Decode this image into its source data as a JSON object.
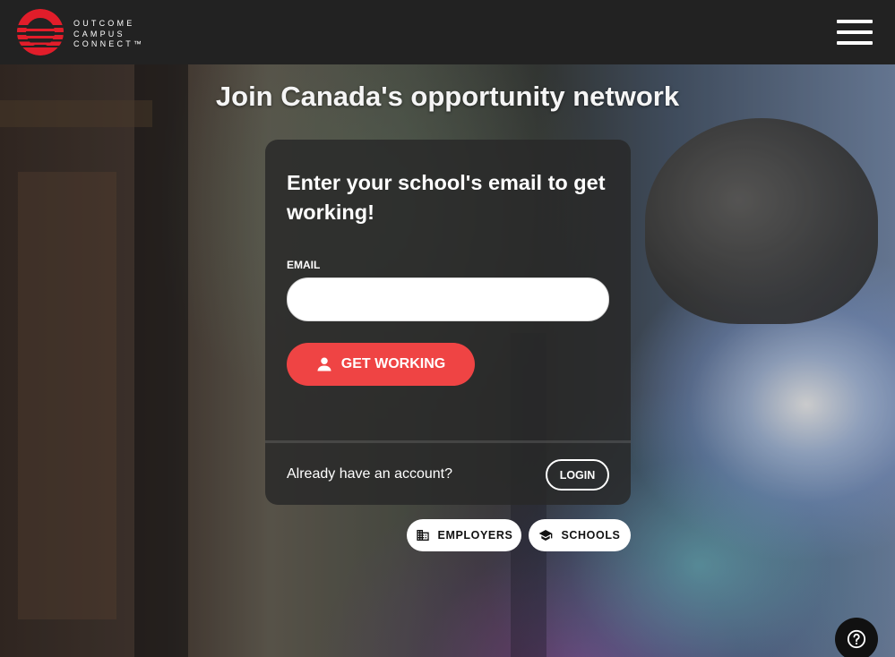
{
  "header": {
    "logo_lines": [
      "OUTCOME",
      "CAMPUS",
      "CONNECT™"
    ],
    "logo_color": "#e11d2a",
    "menu_icon": "hamburger-menu-icon"
  },
  "hero": {
    "headline": "Join Canada's opportunity network"
  },
  "card": {
    "title": "Enter your school's email to get working!",
    "email_label": "EMAIL",
    "email_value": "",
    "email_placeholder": "",
    "submit_label": "GET WORKING",
    "submit_icon": "person-icon",
    "submit_color": "#ef4444",
    "account_prompt": "Already have an account?",
    "login_label": "LOGIN"
  },
  "audience": {
    "employers_label": "EMPLOYERS",
    "employers_icon": "building-icon",
    "schools_label": "SCHOOLS",
    "schools_icon": "graduation-cap-icon"
  },
  "help": {
    "icon": "help-question-icon"
  }
}
